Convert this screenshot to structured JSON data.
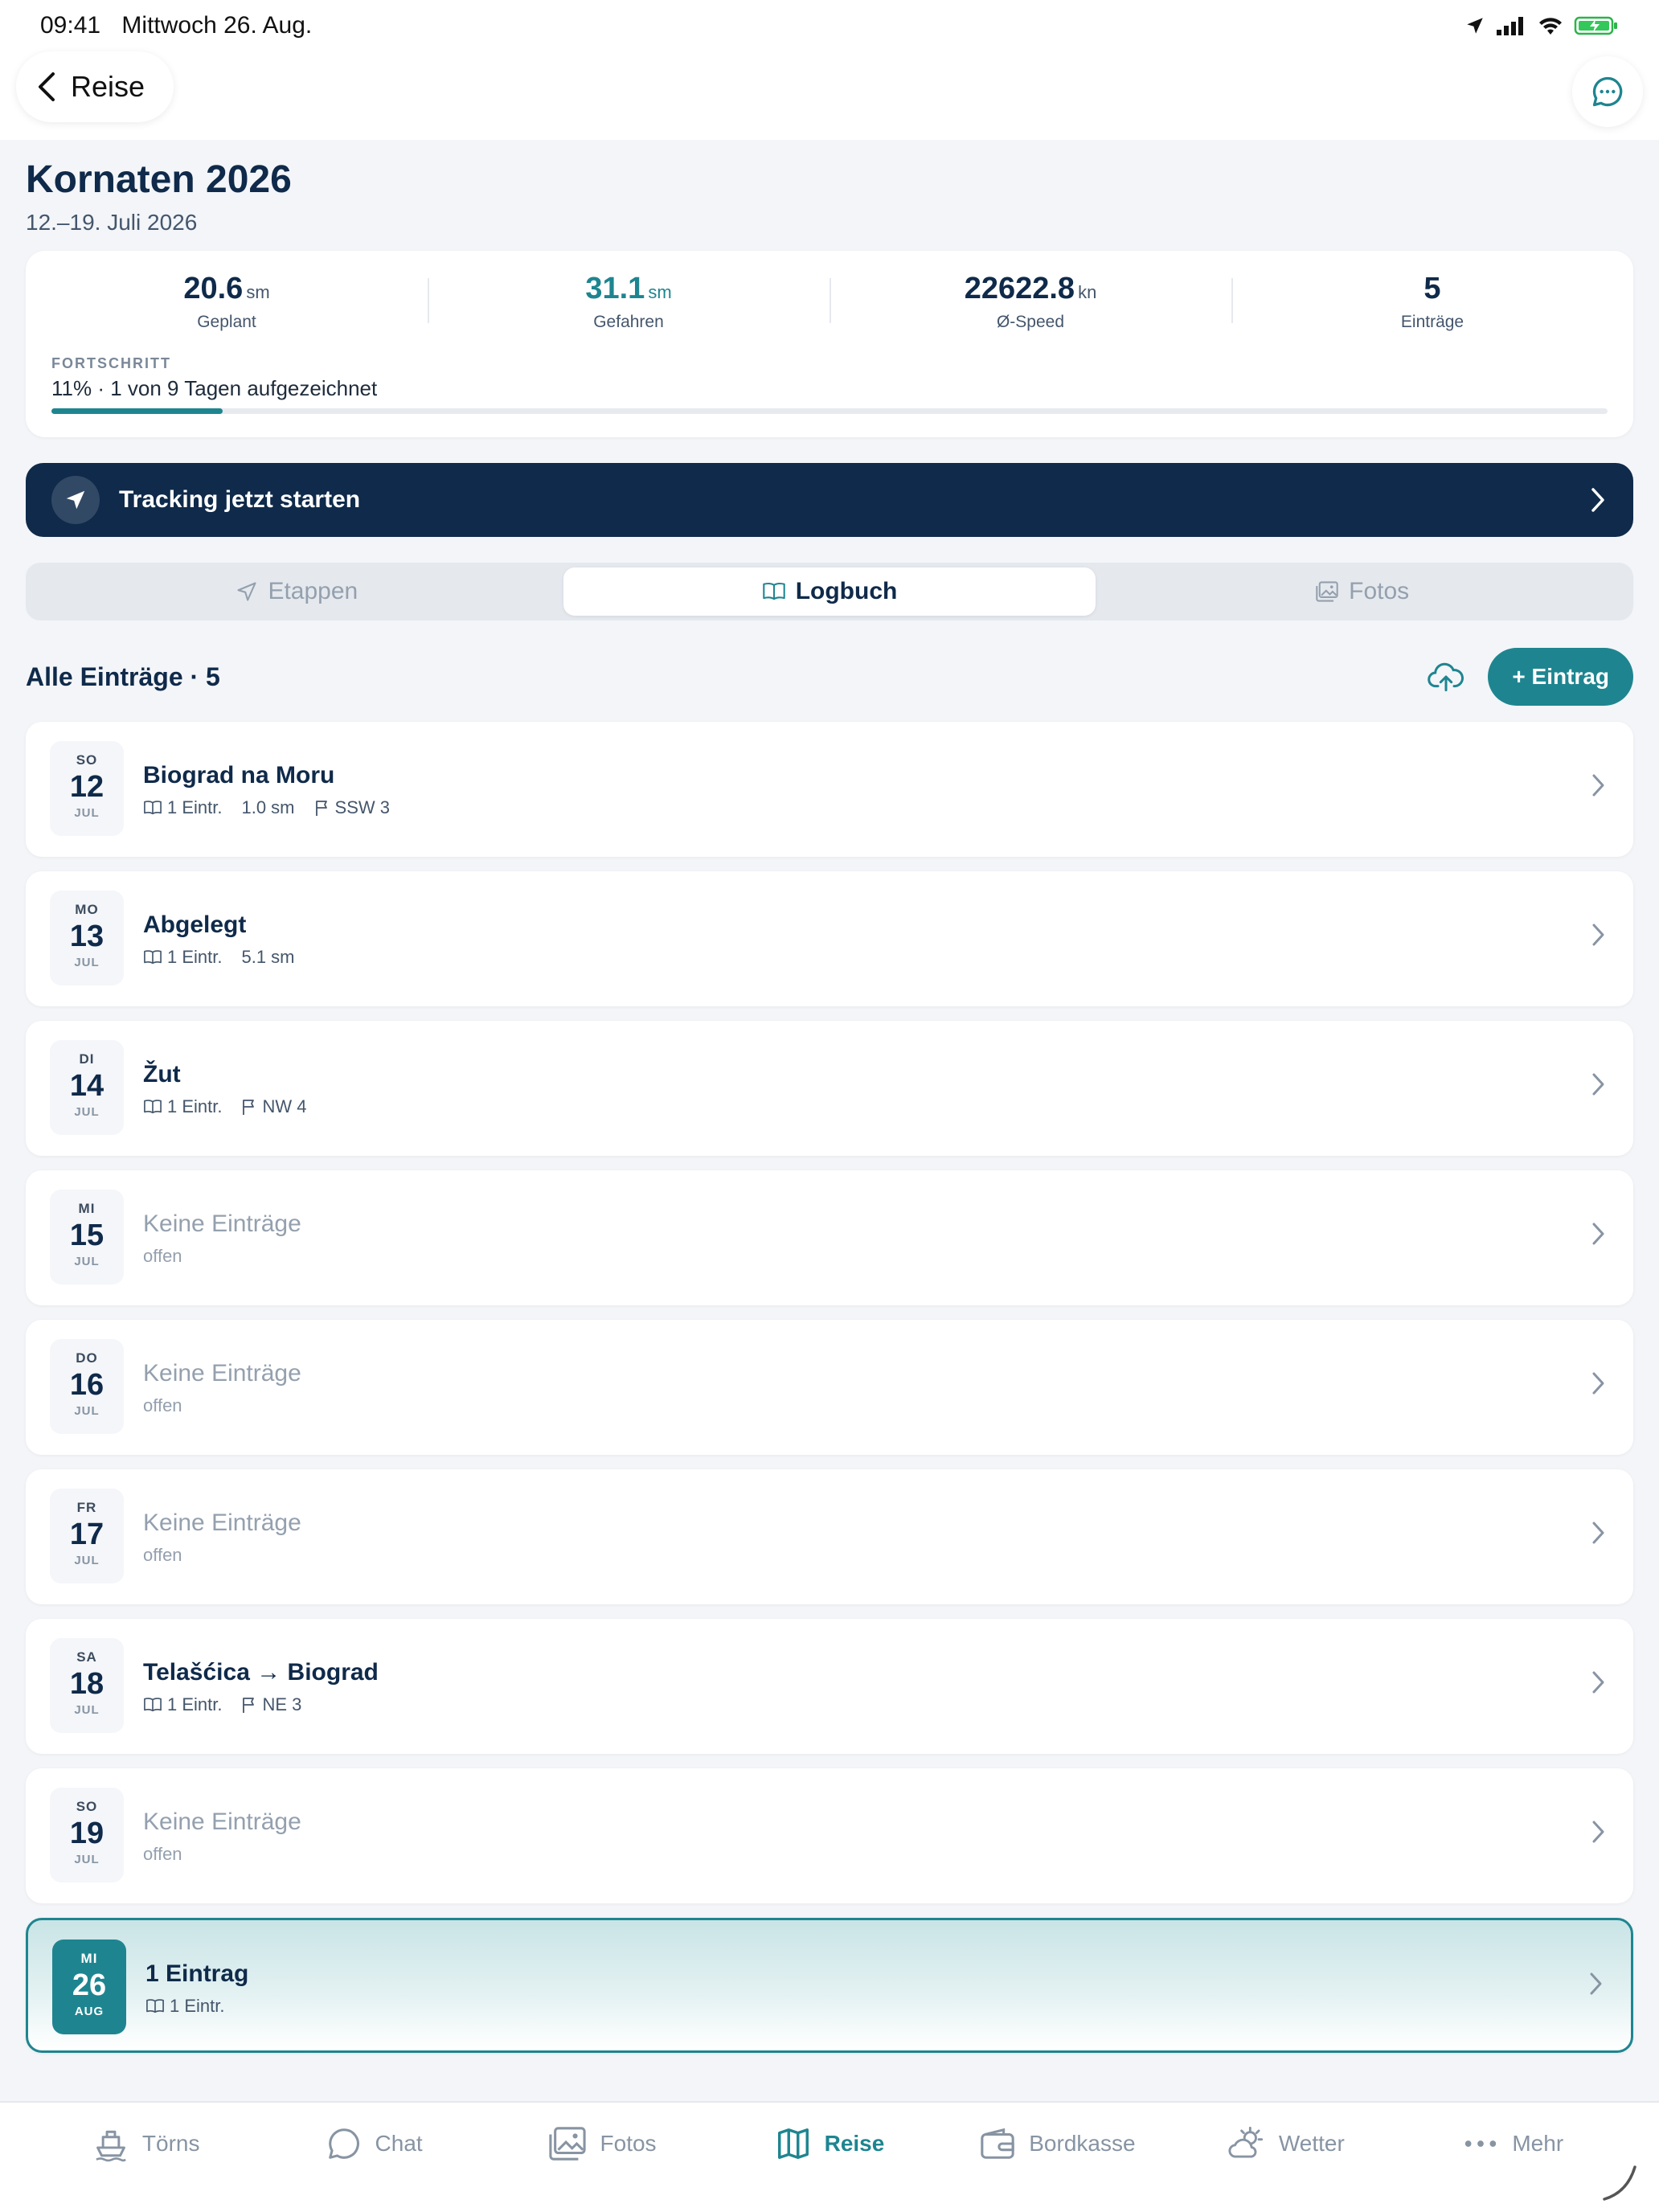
{
  "status_bar": {
    "time": "09:41",
    "date": "Mittwoch 26. Aug.",
    "icons": [
      "location-arrow-icon",
      "signal-icon",
      "wifi-icon",
      "battery-charging-icon"
    ]
  },
  "nav": {
    "back_label": "Reise",
    "chat_icon": "chat-bubble-icon"
  },
  "trip": {
    "title": "Kornaten 2026",
    "dates": "12.–19. Juli 2026"
  },
  "stats": [
    {
      "value": "20.6",
      "unit": "sm",
      "label": "Geplant",
      "highlight": false
    },
    {
      "value": "31.1",
      "unit": "sm",
      "label": "Gefahren",
      "highlight": true
    },
    {
      "value": "22622.8",
      "unit": "kn",
      "label": "Ø-Speed",
      "highlight": false
    },
    {
      "value": "5",
      "unit": "",
      "label": "Einträge",
      "highlight": false
    }
  ],
  "progress": {
    "caption": "FORTSCHRITT",
    "text": "11% · 1 von 9 Tagen aufgezeichnet",
    "percent": 11
  },
  "tracking": {
    "label": "Tracking jetzt starten"
  },
  "tabs": [
    {
      "label": "Etappen",
      "icon": "navigation-arrow-icon",
      "active": false
    },
    {
      "label": "Logbuch",
      "icon": "open-book-icon",
      "active": true
    },
    {
      "label": "Fotos",
      "icon": "photos-icon",
      "active": false
    }
  ],
  "list": {
    "title": "Alle Einträge · 5",
    "add_label": "+ Eintrag"
  },
  "days": [
    {
      "wd": "SO",
      "day": "12",
      "mon": "JUL",
      "title": "Biograd na Moru",
      "empty": false,
      "entries": "1 Eintr.",
      "distance": "1.0 sm",
      "wind": "SSW 3"
    },
    {
      "wd": "MO",
      "day": "13",
      "mon": "JUL",
      "title": "Abgelegt",
      "empty": false,
      "entries": "1 Eintr.",
      "distance": "5.1 sm",
      "wind": ""
    },
    {
      "wd": "DI",
      "day": "14",
      "mon": "JUL",
      "title": "Žut",
      "empty": false,
      "entries": "1 Eintr.",
      "distance": "",
      "wind": "NW 4"
    },
    {
      "wd": "MI",
      "day": "15",
      "mon": "JUL",
      "title": "Keine Einträge",
      "empty": true,
      "status": "offen"
    },
    {
      "wd": "DO",
      "day": "16",
      "mon": "JUL",
      "title": "Keine Einträge",
      "empty": true,
      "status": "offen"
    },
    {
      "wd": "FR",
      "day": "17",
      "mon": "JUL",
      "title": "Keine Einträge",
      "empty": true,
      "status": "offen"
    },
    {
      "wd": "SA",
      "day": "18",
      "mon": "JUL",
      "title": "Telašćica → Biograd",
      "empty": false,
      "entries": "1 Eintr.",
      "distance": "",
      "wind": "NE 3"
    },
    {
      "wd": "SO",
      "day": "19",
      "mon": "JUL",
      "title": "Keine Einträge",
      "empty": true,
      "status": "offen"
    },
    {
      "wd": "MI",
      "day": "26",
      "mon": "AUG",
      "title": "1 Eintrag",
      "empty": false,
      "today": true,
      "entries": "1 Eintr.",
      "distance": "",
      "wind": ""
    }
  ],
  "bottom_tabs": [
    {
      "label": "Törns",
      "icon": "boat-icon",
      "active": false
    },
    {
      "label": "Chat",
      "icon": "chat-bubble-icon",
      "active": false
    },
    {
      "label": "Fotos",
      "icon": "photo-icon",
      "active": false
    },
    {
      "label": "Reise",
      "icon": "map-icon",
      "active": true
    },
    {
      "label": "Bordkasse",
      "icon": "wallet-icon",
      "active": false
    },
    {
      "label": "Wetter",
      "icon": "weather-icon",
      "active": false
    },
    {
      "label": "Mehr",
      "icon": "more-dots-icon",
      "active": false
    }
  ],
  "colors": {
    "navy": "#0f2a4a",
    "teal": "#1e8590",
    "muted": "#94a0ae"
  }
}
